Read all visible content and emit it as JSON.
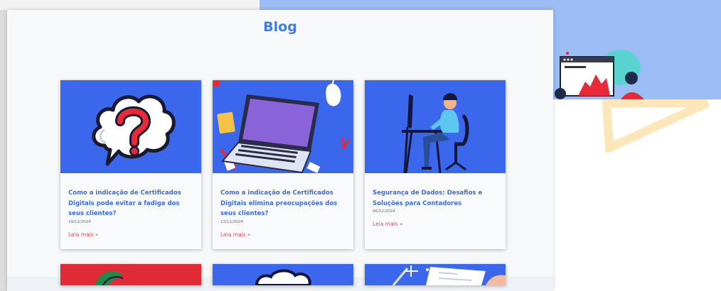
{
  "blog": {
    "title": "Blog",
    "posts": [
      {
        "title": "Como a indicação de Certificados Digitais pode evitar a fadiga dos seus clientes?",
        "date": "19/12/2024",
        "read_more": "Leia mais »",
        "image_icon": "question-cloud-icon"
      },
      {
        "title": "Como a indicação de Certificados Digitais elimina preocupações dos seus clientes?",
        "date": "12/12/2024",
        "read_more": "Leia mais »",
        "image_icon": "laptop-icon"
      },
      {
        "title": "Segurança de Dados: Desafios e Soluções para Contadores",
        "date": "06/12/2024",
        "read_more": "Leia mais »",
        "image_icon": "person-at-computer-icon"
      }
    ]
  },
  "colors": {
    "accent": "#3f7de3",
    "card_image_bg": "#3a67ec",
    "link": "#e5506b",
    "hero_bg": "#9bbcf4"
  }
}
